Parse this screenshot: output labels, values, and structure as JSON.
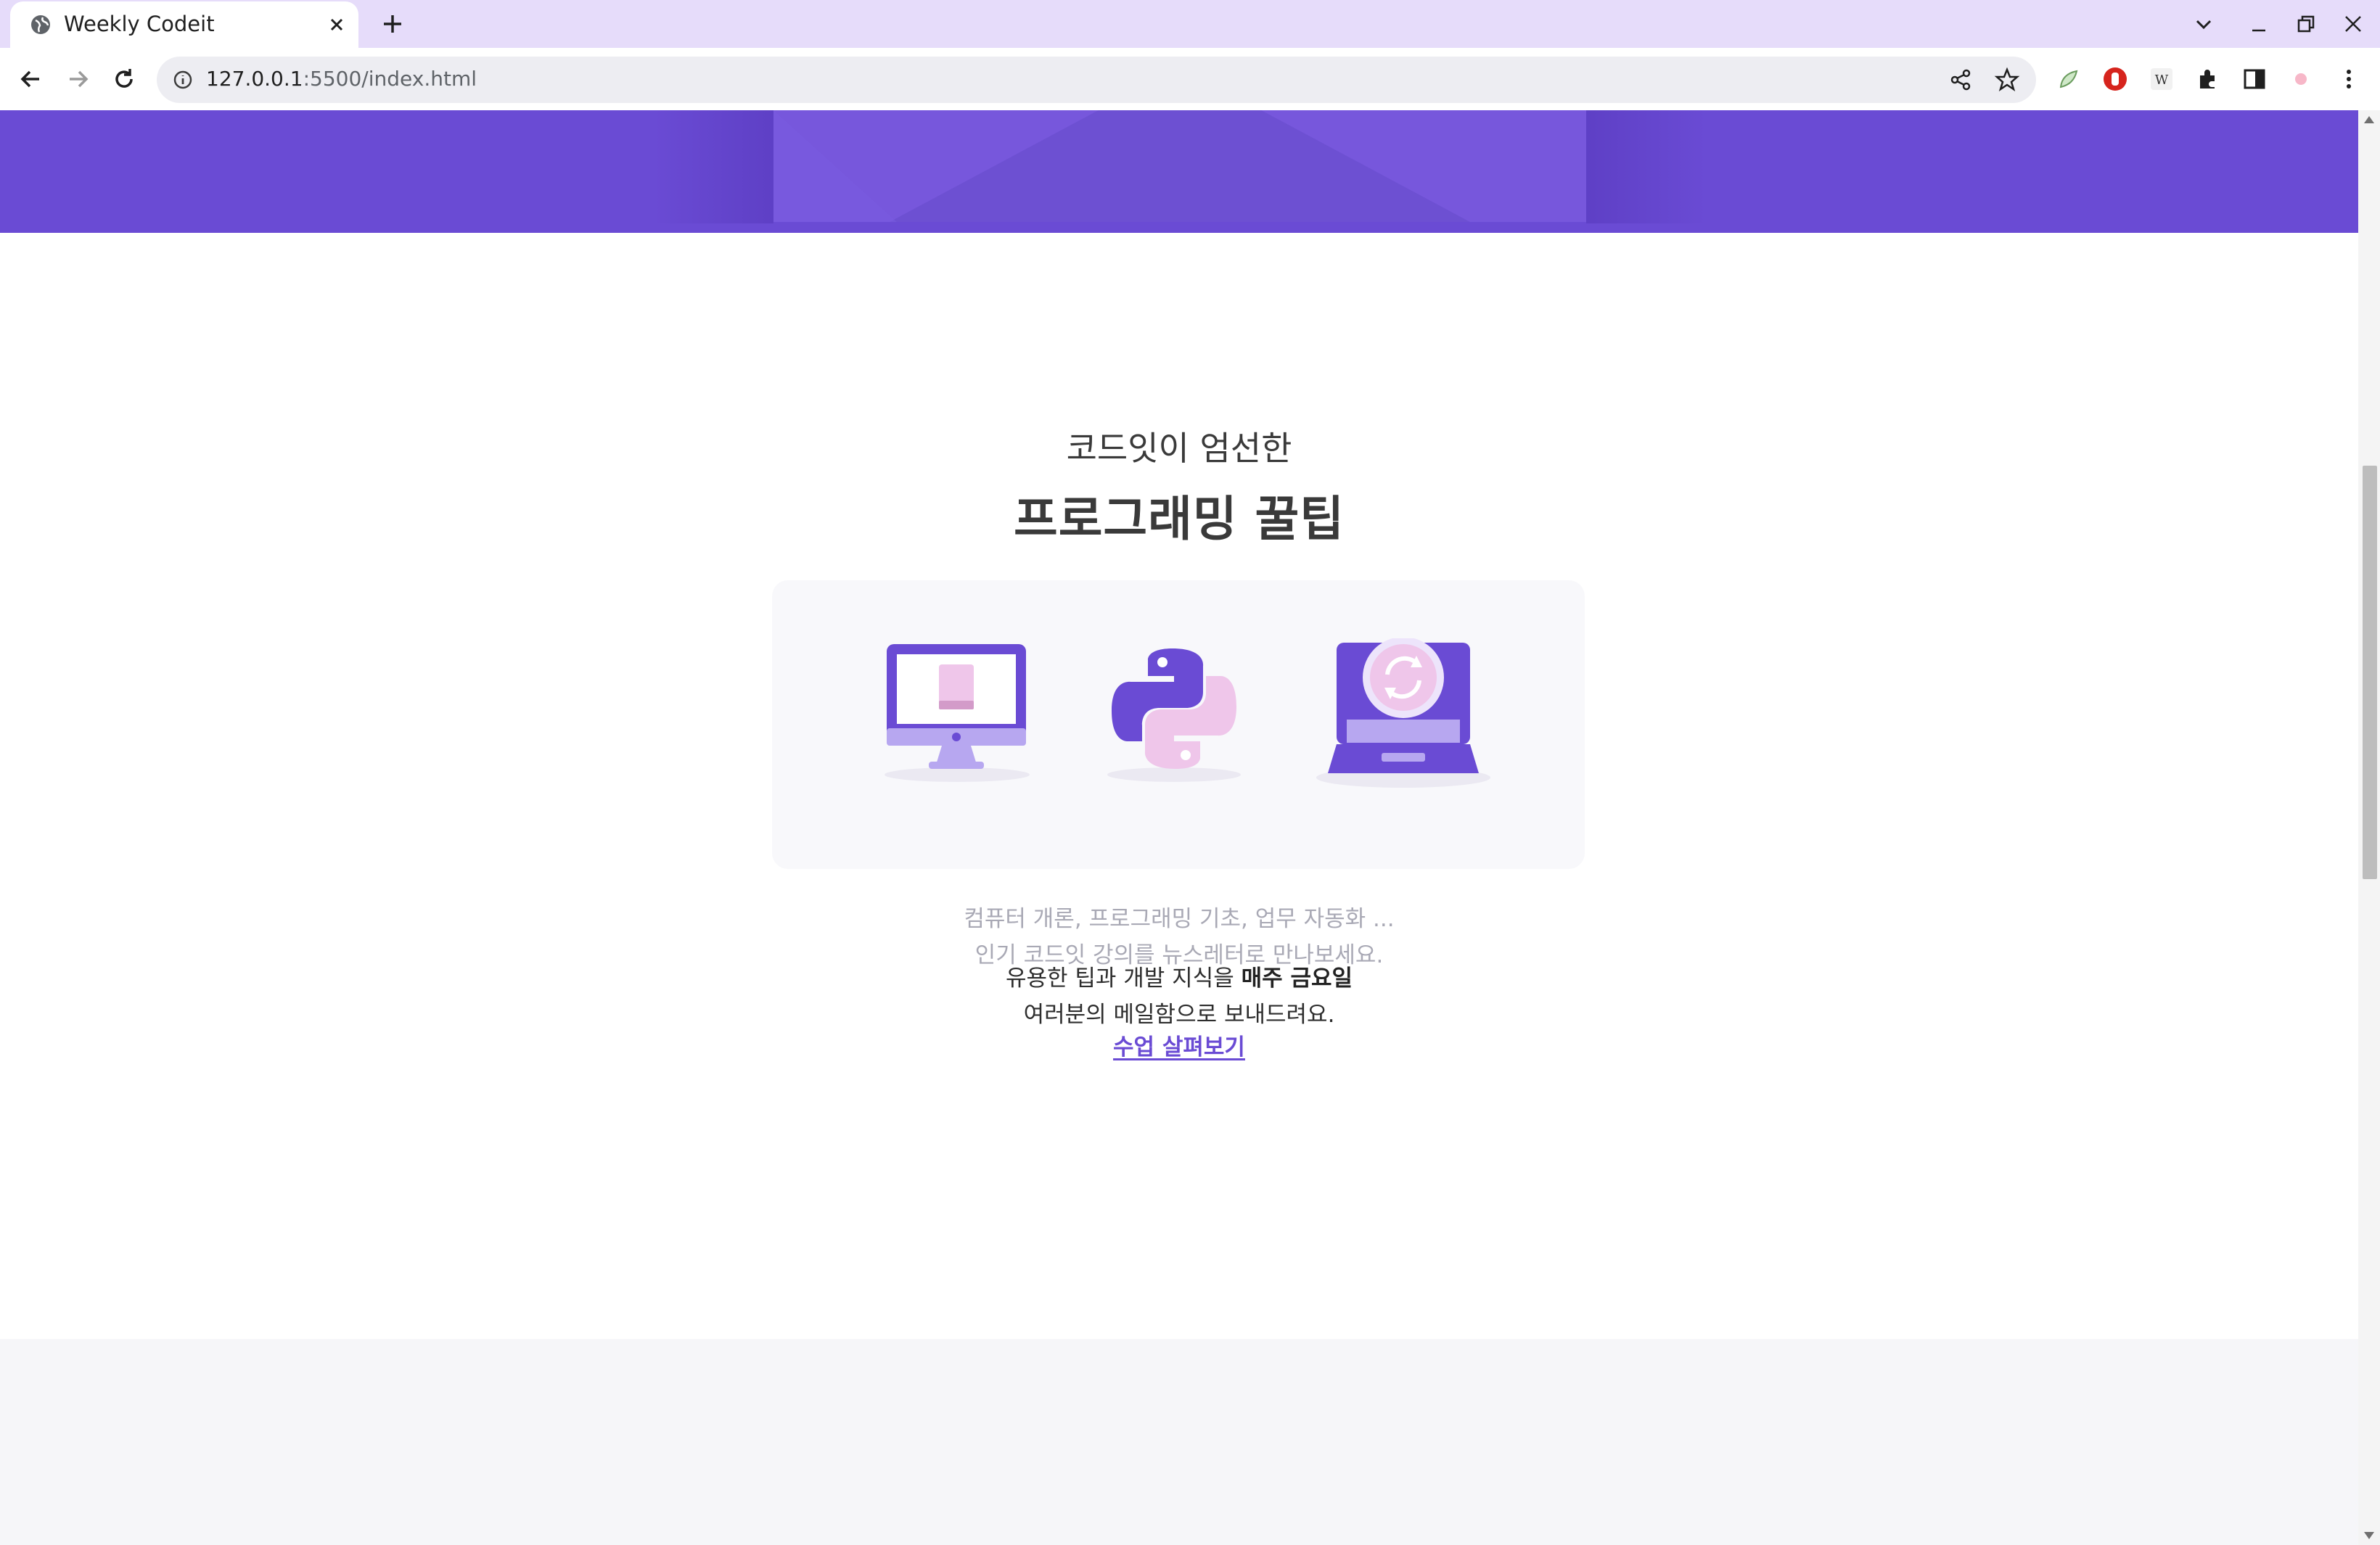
{
  "browser": {
    "tab_title": "Weekly Codeit",
    "url_host": "127.0.0.1",
    "url_path": ":5500/index.html",
    "accent_color": "#e6dcfa"
  },
  "hero": {
    "band_color": "#6a4bd4",
    "card_color": "#7757dc"
  },
  "section": {
    "subtitle": "코드잇이 엄선한",
    "title": "프로그래밍 꿀팁",
    "description_line1": "컴퓨터 개론, 프로그래밍 기초, 업무 자동화 ...",
    "description_line2": "인기 코드잇 강의를 뉴스레터로 만나보세요.",
    "info_line1_prefix": "유용한 팁과 개발 지식을 ",
    "info_line1_bold": "매주 금요일",
    "info_line2": "여러분의 메일함으로 보내드려요.",
    "cta_label": "수업 살펴보기",
    "icons": [
      "monitor-icon",
      "python-logo-icon",
      "laptop-sync-icon"
    ],
    "primary_color": "#6a4bd4",
    "secondary_color": "#efc6ea"
  }
}
